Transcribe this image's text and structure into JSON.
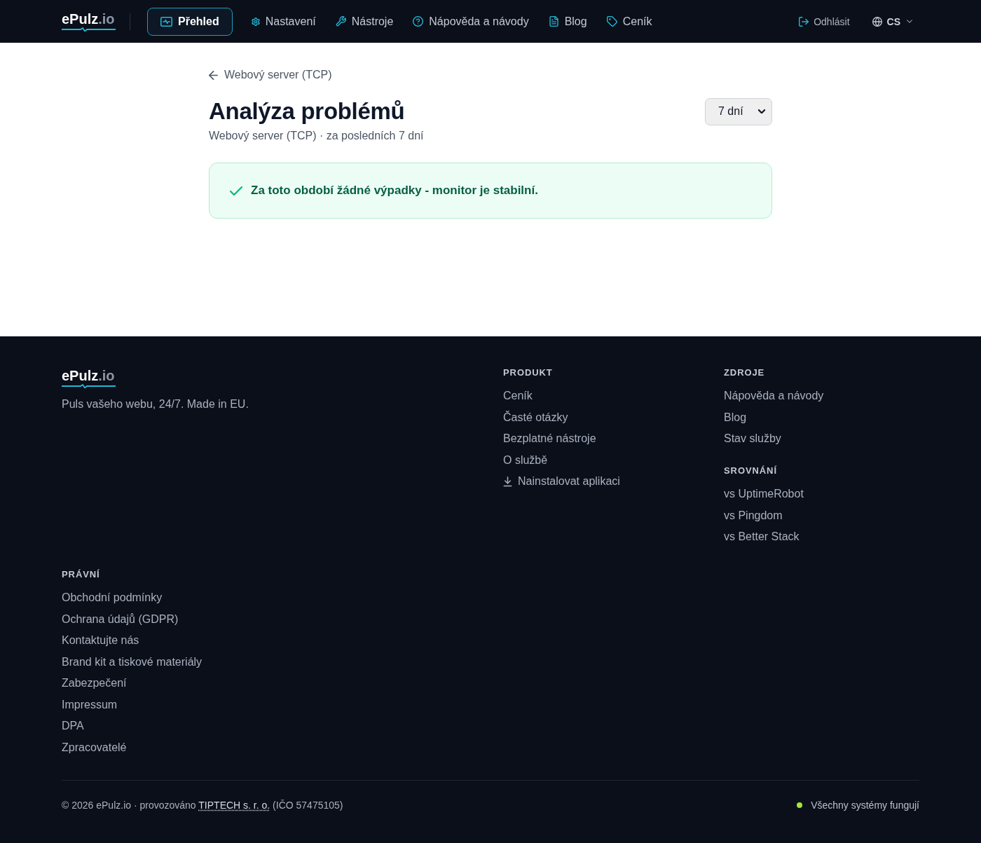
{
  "header": {
    "logo": {
      "name": "ePulz",
      "suffix": ".io"
    },
    "nav": [
      {
        "kind": "overview",
        "label": "Přehled",
        "selected": true
      },
      {
        "kind": "settings",
        "label": "Nastavení",
        "selected": false
      },
      {
        "kind": "tools",
        "label": "Nástroje",
        "selected": false
      },
      {
        "kind": "help",
        "label": "Nápověda a návody",
        "selected": false
      },
      {
        "kind": "blog",
        "label": "Blog",
        "selected": false
      },
      {
        "kind": "pricing",
        "label": "Ceník",
        "selected": false
      }
    ],
    "logout": "Odhlásit",
    "language": "CS"
  },
  "page": {
    "back_link": "Webový server (TCP)",
    "title": "Analýza problémů",
    "subtitle": "Webový server (TCP) · za posledních 7 dní",
    "period_select": {
      "value": "7 dní"
    },
    "alert": {
      "kind": "success",
      "text": "Za toto období žádné výpadky - monitor je stabilní."
    }
  },
  "footer": {
    "logo": {
      "name": "ePulz",
      "suffix": ".io"
    },
    "tagline": "Puls vašeho webu, 24/7. Made in EU.",
    "columns": [
      {
        "sections": [
          {
            "heading": "PRODUKT",
            "links": [
              {
                "kind": "link",
                "label": "Ceník"
              },
              {
                "kind": "link",
                "label": "Časté otázky"
              },
              {
                "kind": "link",
                "label": "Bezplatné nástroje"
              },
              {
                "kind": "link",
                "label": "O službě"
              },
              {
                "kind": "download",
                "label": "Nainstalovat aplikaci"
              }
            ]
          }
        ]
      },
      {
        "sections": [
          {
            "heading": "ZDROJE",
            "links": [
              {
                "kind": "link",
                "label": "Nápověda a návody"
              },
              {
                "kind": "link",
                "label": "Blog"
              },
              {
                "kind": "link",
                "label": "Stav služby"
              }
            ]
          },
          {
            "heading": "SROVNÁNÍ",
            "links": [
              {
                "kind": "link",
                "label": "vs UptimeRobot"
              },
              {
                "kind": "link",
                "label": "vs Pingdom"
              },
              {
                "kind": "link",
                "label": "vs Better Stack"
              }
            ]
          }
        ]
      },
      {
        "sections": [
          {
            "heading": "PRÁVNÍ",
            "links": [
              {
                "kind": "link",
                "label": "Obchodní podmínky"
              },
              {
                "kind": "link",
                "label": "Ochrana údajů (GDPR)"
              },
              {
                "kind": "link",
                "label": "Kontaktujte nás"
              },
              {
                "kind": "link",
                "label": "Brand kit a tiskové materiály"
              },
              {
                "kind": "link",
                "label": "Zabezpečení"
              },
              {
                "kind": "link",
                "label": "Impressum"
              },
              {
                "kind": "link",
                "label": "DPA"
              },
              {
                "kind": "link",
                "label": "Zpracovatelé"
              }
            ]
          }
        ]
      }
    ],
    "copyright": {
      "before": "© 2026 ePulz.io · provozováno",
      "link": "TIPTECH s. r. o.",
      "after": "(IČO 57475105)"
    },
    "status": {
      "text": "Všechny systémy fungují",
      "color": "#a3e635"
    }
  }
}
